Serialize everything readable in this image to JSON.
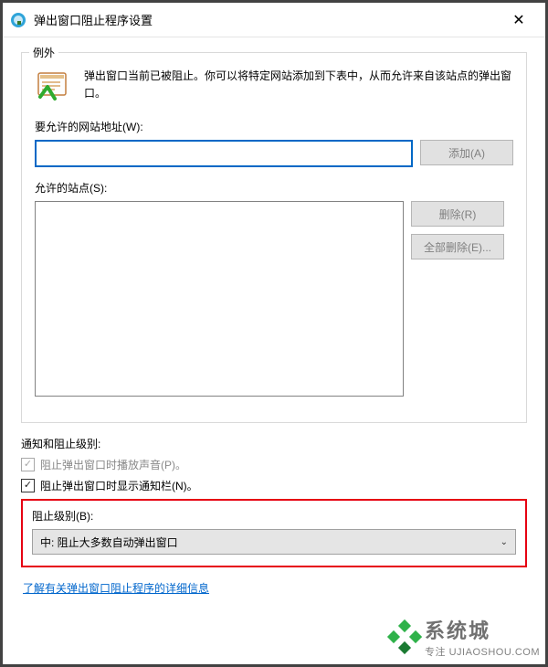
{
  "title": "弹出窗口阻止程序设置",
  "exceptions": {
    "legend": "例外",
    "info": "弹出窗口当前已被阻止。你可以将特定网站添加到下表中，从而允许来自该站点的弹出窗口。",
    "address_label": "要允许的网站地址(W):",
    "add_btn": "添加(A)",
    "sites_label": "允许的站点(S):",
    "remove_btn": "删除(R)",
    "remove_all_btn": "全部删除(E)..."
  },
  "notification": {
    "legend": "通知和阻止级别:",
    "play_sound_label": "阻止弹出窗口时播放声音(P)。",
    "show_bar_label": "阻止弹出窗口时显示通知栏(N)。",
    "level_label": "阻止级别(B):",
    "level_value": "中: 阻止大多数自动弹出窗口"
  },
  "link_text": "了解有关弹出窗口阻止程序的详细信息",
  "watermark": {
    "line1": "系统城",
    "line2": "专注 UJIAOSHOU.COM"
  }
}
